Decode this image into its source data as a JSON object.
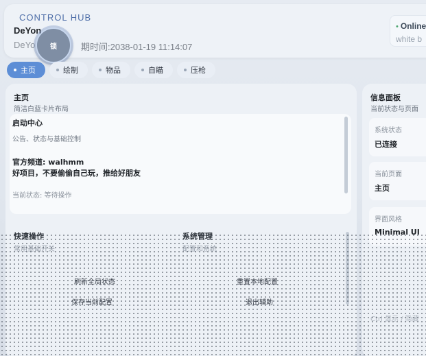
{
  "header": {
    "brand": "CONTROL HUB",
    "user_name": "DeYon",
    "user_name_2": "DeYo",
    "expire_text": "期时间:2038-01-19 11:14:07",
    "fab_label": "锁"
  },
  "status": {
    "title": "Online",
    "subtitle": "white b"
  },
  "tabs": [
    {
      "label": "主页",
      "active": true
    },
    {
      "label": "绘制"
    },
    {
      "label": "物品"
    },
    {
      "label": "自瞄"
    },
    {
      "label": "压枪"
    }
  ],
  "main": {
    "title": "主页",
    "subtitle": "简洁白蓝卡片布局",
    "card": {
      "heading": "启动中心",
      "desc": "公告、状态与基础控制",
      "channel": "官方频道: walhmm",
      "notice": "好项目，不要偷偷自己玩，推给好朋友",
      "state": "当前状态: 等待操作"
    },
    "quick": {
      "title": "快速操作",
      "subtitle": "常用基础开关",
      "btn1": "刷新全局状态",
      "btn2": "保存当前配置"
    },
    "system": {
      "title": "系统管理",
      "subtitle": "配置和系统",
      "btn1": "重置本地配置",
      "btn2": "退出辅助"
    }
  },
  "side": {
    "title": "信息面板",
    "subtitle": "当前状态与页面",
    "items": [
      {
        "key": "系统状态",
        "value": "已连接"
      },
      {
        "key": "当前页面",
        "value": "主页"
      },
      {
        "key": "界面风格",
        "value": "Minimal UI"
      }
    ],
    "footer": "Ctrl 显示 / 隐藏"
  },
  "colors": {
    "accent": "#5d8ed6",
    "online": "#4aa56d",
    "background": "#dfe6ef"
  }
}
